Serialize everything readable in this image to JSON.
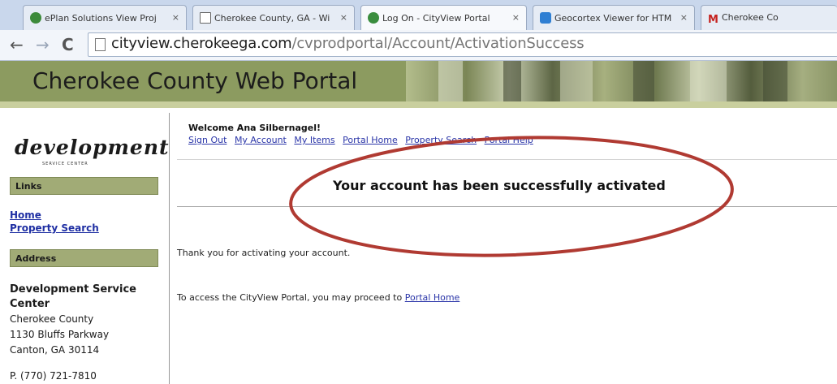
{
  "browser": {
    "tabs": [
      {
        "label": "ePlan Solutions View Proj",
        "favicon_color": "#3c8a3a"
      },
      {
        "label": "Cherokee County, GA - Wi",
        "favicon_color": "#ffffff"
      },
      {
        "label": "Log On - CityView Portal",
        "favicon_color": "#3a8d3e"
      },
      {
        "label": "Geocortex Viewer for HTM",
        "favicon_color": "#2f7fd3"
      },
      {
        "label": "Cherokee Co",
        "favicon_color": "#c5221f"
      }
    ],
    "tab_close_glyph": "×",
    "url_host": "cityview.cherokeega.com",
    "url_path": "/cvprodportal/Account/ActivationSuccess"
  },
  "header": {
    "title": "Cherokee County Web Portal"
  },
  "sidebar": {
    "logo_text": "development",
    "logo_subtext": "SERVICE CENTER",
    "links_heading": "Links",
    "links": [
      "Home",
      "Property Search"
    ],
    "address_heading": "Address",
    "address_lines": [
      "Development Service",
      "Center"
    ],
    "address_detail": [
      "Cherokee County",
      "1130 Bluffs Parkway",
      "Canton, GA 30114"
    ],
    "phone": "P. (770) 721-7810"
  },
  "main": {
    "welcome": "Welcome Ana Silbernagel!",
    "nav": [
      "Sign Out",
      "My Account",
      "My Items",
      "Portal Home",
      "Property Search",
      "Portal Help"
    ],
    "headline": "Your account has been successfully activated",
    "thank_you": "Thank you for activating your account.",
    "access_text": "To access the CityView Portal, you may proceed to ",
    "access_link": "Portal Home"
  },
  "colors": {
    "banner": "#8c9b60",
    "section_header": "#a1ab76",
    "link": "#2a35a8",
    "annotation": "#b03a32"
  },
  "icons": [
    "back-arrow-icon",
    "forward-arrow-icon",
    "reload-icon",
    "page-icon",
    "tab-favicon"
  ]
}
